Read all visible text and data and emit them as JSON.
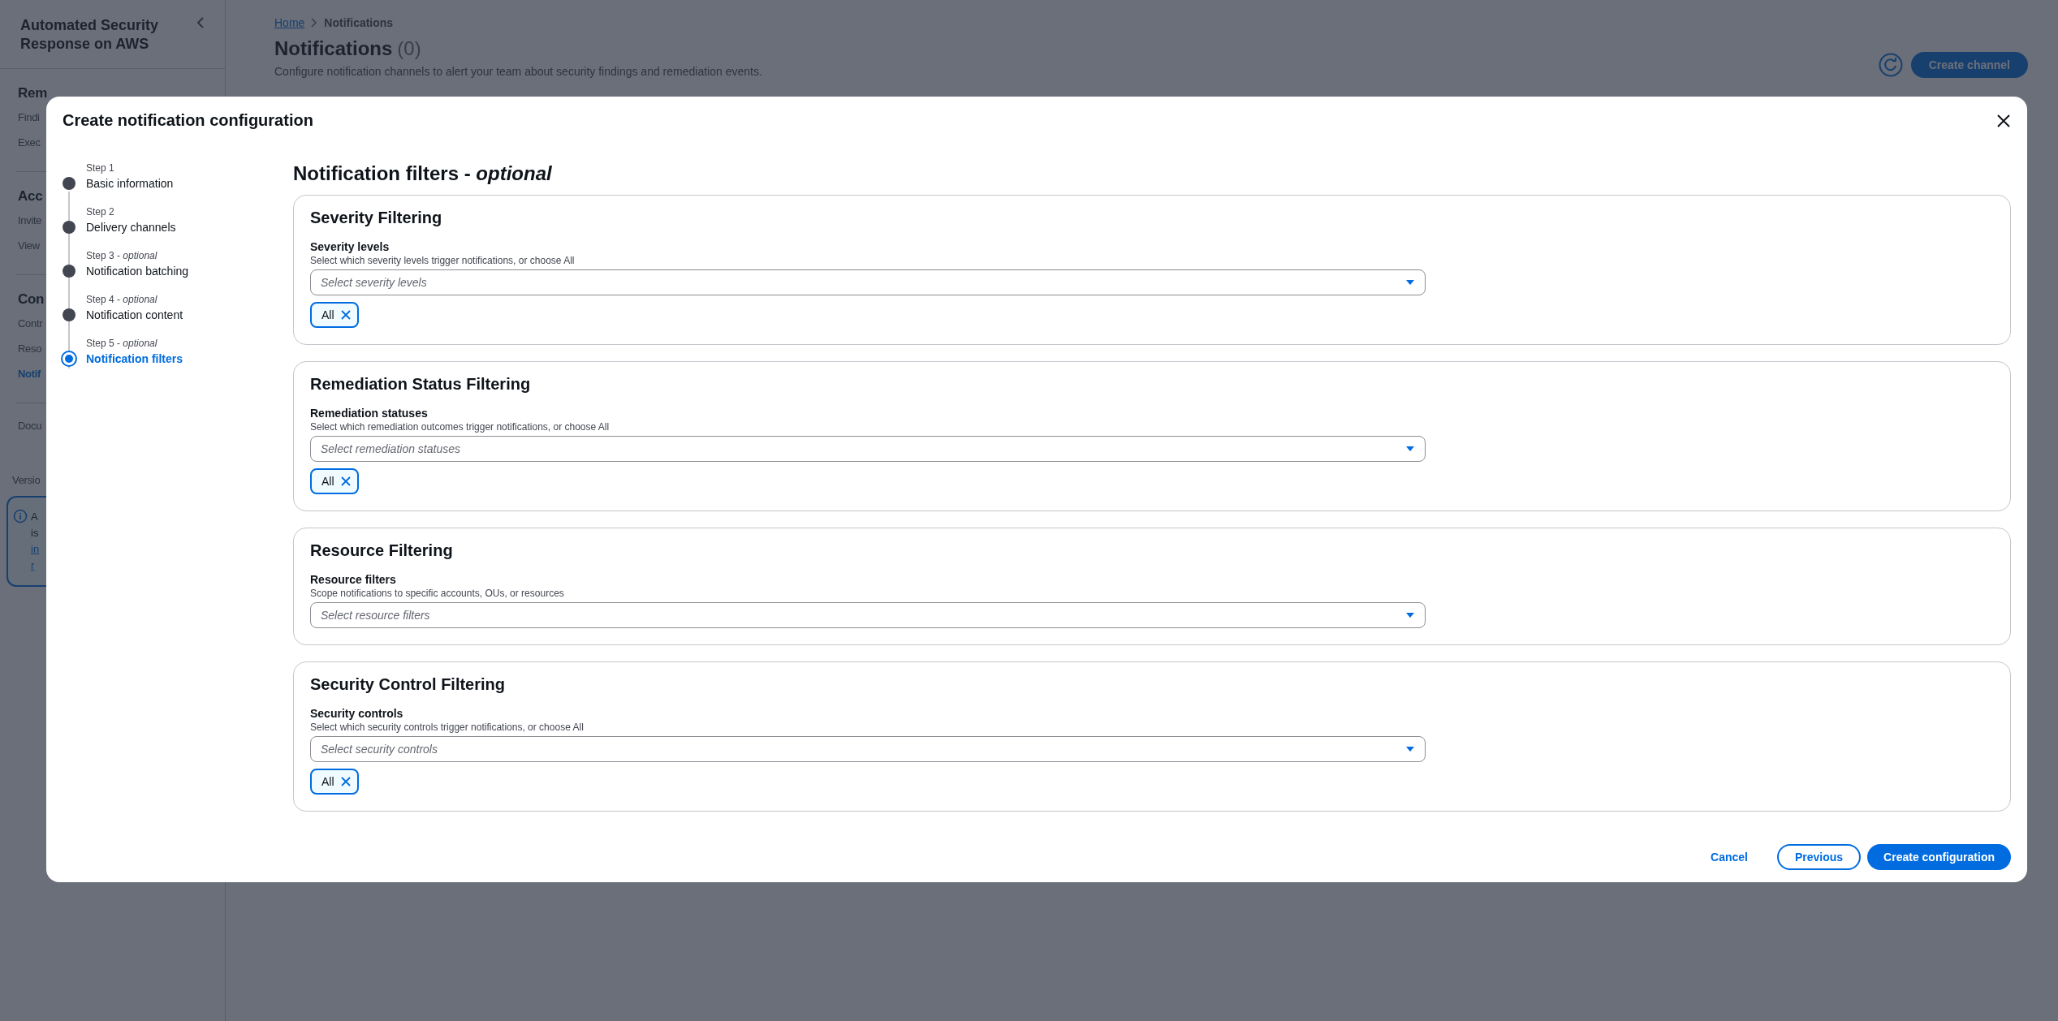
{
  "background_page": {
    "sidebar": {
      "title": "Automated Security Response on AWS",
      "sections": [
        {
          "heading": "Rem",
          "items": [
            {
              "label": "Findi",
              "selected": false
            },
            {
              "label": "Exec",
              "selected": false
            }
          ]
        },
        {
          "heading": "Acc",
          "items": [
            {
              "label": "Invite",
              "selected": false
            },
            {
              "label": "View",
              "selected": false
            }
          ]
        },
        {
          "heading": "Con",
          "items": [
            {
              "label": "Contr",
              "selected": false
            },
            {
              "label": "Reso",
              "selected": false
            },
            {
              "label": "Notif",
              "selected": true
            }
          ]
        }
      ],
      "footer_items": [
        {
          "label": "Docu",
          "selected": false
        }
      ],
      "version": "Versio",
      "info_box": {
        "texts": [
          "A",
          "is"
        ],
        "links": [
          "in",
          "r"
        ]
      }
    },
    "breadcrumbs": [
      {
        "label": "Home",
        "kind": "link"
      },
      {
        "label": "Notifications",
        "kind": "current"
      }
    ],
    "title": "Notifications",
    "count": "(0)",
    "description": "Configure notification channels to alert your team about security findings and remediation events.",
    "primary_button": "Create channel"
  },
  "modal": {
    "title": "Create notification configuration",
    "steps": [
      {
        "step": "Step 1",
        "label": "Basic information",
        "selected": false
      },
      {
        "step": "Step 2",
        "label": "Delivery channels",
        "selected": false
      },
      {
        "step": "Step 3 - *optional*",
        "label": "Notification batching",
        "selected": false
      },
      {
        "step": "Step 4 - *optional*",
        "label": "Notification content",
        "selected": false
      },
      {
        "step": "Step 5 - *optional*",
        "label": "Notification filters",
        "selected": true
      }
    ],
    "heading": "Notification filters - *optional*",
    "sections": [
      {
        "title": "Severity Filtering",
        "field_label": "Severity levels",
        "description": "Select which severity levels trigger notifications, or choose All",
        "placeholder": "Select severity levels",
        "tokens": [
          "All"
        ]
      },
      {
        "title": "Remediation Status Filtering",
        "field_label": "Remediation statuses",
        "description": "Select which remediation outcomes trigger notifications, or choose All",
        "placeholder": "Select remediation statuses",
        "tokens": [
          "All"
        ]
      },
      {
        "title": "Resource Filtering",
        "field_label": "Resource filters",
        "description": "Scope notifications to specific accounts, OUs, or resources",
        "placeholder": "Select resource filters"
      },
      {
        "title": "Security Control Filtering",
        "field_label": "Security controls",
        "description": "Select which security controls trigger notifications, or choose All",
        "placeholder": "Select security controls",
        "tokens": [
          "All"
        ]
      }
    ],
    "buttons": [
      {
        "label": "Cancel",
        "kind": "link"
      },
      {
        "label": "Previous",
        "kind": "secondary"
      },
      {
        "label": "Create configuration",
        "kind": "primary"
      }
    ]
  }
}
